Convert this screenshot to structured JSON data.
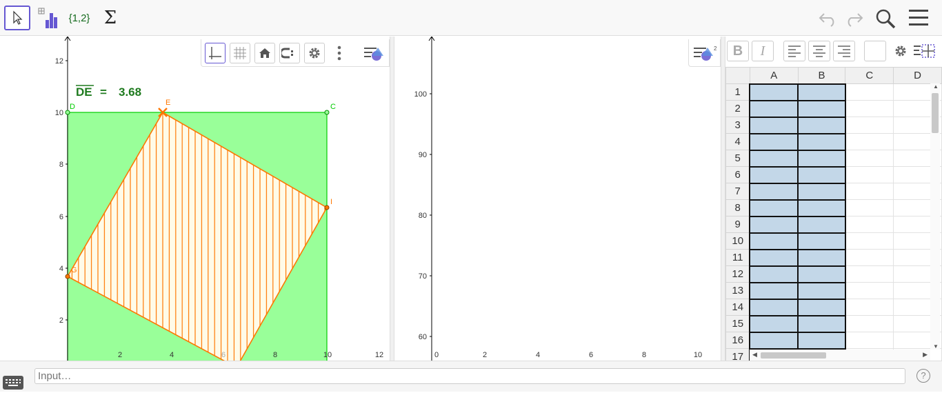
{
  "toolbar": {
    "tools": [
      {
        "name": "move-tool",
        "icon": "cursor-arrow-icon"
      },
      {
        "name": "two-variable-analysis-tool",
        "icon": "bar-chart-icon"
      },
      {
        "name": "create-list-tool",
        "label": "{1,2}"
      },
      {
        "name": "sum-tool",
        "label": "Σ"
      }
    ],
    "right_icons": [
      "undo-icon",
      "redo-icon",
      "search-icon",
      "menu-icon"
    ]
  },
  "graphics1": {
    "stylebar_icons": [
      "axes-icon",
      "grid-icon",
      "home-icon",
      "point-capturing-icon",
      "settings-icon",
      "more-icon",
      "stylebar-toggle-icon"
    ],
    "measurement_label": "DE",
    "measurement_value": "3.68",
    "x_ticks": [
      "2",
      "4",
      "6",
      "8",
      "10",
      "12"
    ],
    "y_ticks": [
      "2",
      "4",
      "6",
      "8",
      "10",
      "12"
    ],
    "points": [
      {
        "label": "D",
        "x": 0,
        "y": 10
      },
      {
        "label": "C",
        "x": 10,
        "y": 10
      },
      {
        "label": "E",
        "x": 3.68,
        "y": 10
      },
      {
        "label": "I",
        "x": 10,
        "y": 6.32
      },
      {
        "label": "G",
        "x": 0,
        "y": 3.68
      }
    ],
    "colors": {
      "square_fill": "#99ff99",
      "square_stroke": "#00cc00",
      "quad_stroke": "#ff7700"
    }
  },
  "graphics2": {
    "x_ticks": [
      "0",
      "2",
      "4",
      "6",
      "8",
      "10"
    ],
    "y_ticks": [
      "60",
      "70",
      "80",
      "90",
      "100"
    ],
    "stylebar_icon": "stylebar-toggle-icon-2"
  },
  "spreadsheet": {
    "toolbar": {
      "bold": "B",
      "italic": "I"
    },
    "columns": [
      "A",
      "B",
      "C",
      "D"
    ],
    "rows": [
      "1",
      "2",
      "3",
      "4",
      "5",
      "6",
      "7",
      "8",
      "9",
      "10",
      "11",
      "12",
      "13",
      "14",
      "15",
      "16",
      "17"
    ]
  },
  "input_bar": {
    "placeholder": "Input…",
    "help": "?"
  }
}
